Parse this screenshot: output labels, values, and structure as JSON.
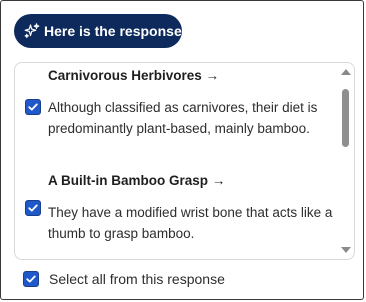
{
  "header": {
    "title": "Here is the response:",
    "icon": "sparkles-icon",
    "background": "#0e2a5c"
  },
  "items": [
    {
      "title": "Carnivorous Herbivores →",
      "text": "Although classified as carnivores, their diet is predominantly plant-based, mainly bamboo.",
      "checked": true
    },
    {
      "title": "A Built-in Bamboo Grasp →",
      "text": "They have a modified wrist bone that acts like a thumb to grasp bamboo.",
      "checked": true
    }
  ],
  "select_all": {
    "label": "Select all from this response",
    "checked": true
  },
  "colors": {
    "checkbox": "#1f58c8",
    "border": "#d9d9d9"
  }
}
